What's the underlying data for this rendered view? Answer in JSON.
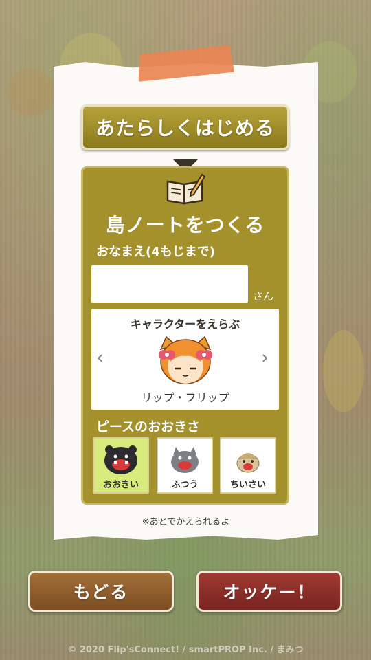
{
  "header": {
    "new_game_button": "あたらしくはじめる"
  },
  "panel": {
    "title": "島ノートをつくる",
    "name_label": "おなまえ(4もじまで)",
    "name_value": "",
    "name_suffix": "さん",
    "character": {
      "title": "キャラクターをえらぶ",
      "name": "リップ・フリップ",
      "prev_icon": "chevron-left-icon",
      "next_icon": "chevron-right-icon"
    },
    "piece_size": {
      "label": "ピースのおおきさ",
      "options": [
        {
          "label": "おおきい",
          "selected": true,
          "icon": "black-monster-icon"
        },
        {
          "label": "ふつう",
          "selected": false,
          "icon": "gray-monster-icon"
        },
        {
          "label": "ちいさい",
          "selected": false,
          "icon": "beige-monster-icon"
        }
      ]
    }
  },
  "note": "※あとでかえられるよ",
  "footer": {
    "back_button": "もどる",
    "ok_button": "オッケー！",
    "copyright": "© 2020 Flip'sConnect! / smartPROP Inc. / まみつ"
  },
  "colors": {
    "panel": "#a4912c",
    "selected_option": "#d7ea7c",
    "back_button": "#8f5d2c",
    "ok_button": "#8e2f28",
    "tape": "#e98552"
  }
}
